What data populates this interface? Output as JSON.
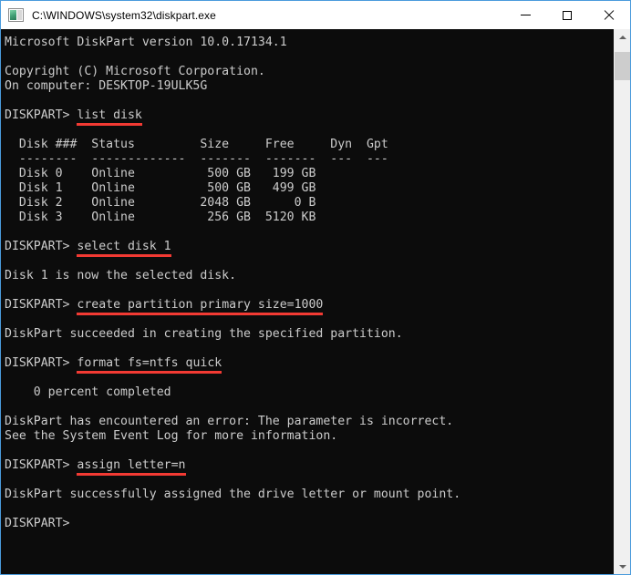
{
  "window": {
    "title": "C:\\WINDOWS\\system32\\diskpart.exe",
    "icon": "console-icon",
    "border_color": "#4a9bdc",
    "controls": {
      "minimize_label": "—",
      "maximize_label": "□",
      "close_label": "✕"
    }
  },
  "terminal": {
    "background": "#0c0c0c",
    "foreground": "#cccccc",
    "highlight_color": "#f23a33",
    "lines": [
      {
        "text": "Microsoft DiskPart version 10.0.17134.1"
      },
      {
        "text": ""
      },
      {
        "text": "Copyright (C) Microsoft Corporation."
      },
      {
        "text": "On computer: DESKTOP-19ULK5G"
      },
      {
        "text": ""
      },
      {
        "prompt": "DISKPART> ",
        "command": "list disk",
        "underline": true
      },
      {
        "text": ""
      },
      {
        "text": "  Disk ###  Status         Size     Free     Dyn  Gpt"
      },
      {
        "text": "  --------  -------------  -------  -------  ---  ---"
      },
      {
        "text": "  Disk 0    Online          500 GB   199 GB"
      },
      {
        "text": "  Disk 1    Online          500 GB   499 GB"
      },
      {
        "text": "  Disk 2    Online         2048 GB      0 B"
      },
      {
        "text": "  Disk 3    Online          256 GB  5120 KB"
      },
      {
        "text": ""
      },
      {
        "prompt": "DISKPART> ",
        "command": "select disk 1",
        "underline": true
      },
      {
        "text": ""
      },
      {
        "text": "Disk 1 is now the selected disk."
      },
      {
        "text": ""
      },
      {
        "prompt": "DISKPART> ",
        "command": "create partition primary size=1000",
        "underline": true
      },
      {
        "text": ""
      },
      {
        "text": "DiskPart succeeded in creating the specified partition."
      },
      {
        "text": ""
      },
      {
        "prompt": "DISKPART> ",
        "command": "format fs=ntfs quick",
        "underline": true
      },
      {
        "text": ""
      },
      {
        "text": "    0 percent completed"
      },
      {
        "text": ""
      },
      {
        "text": "DiskPart has encountered an error: The parameter is incorrect."
      },
      {
        "text": "See the System Event Log for more information."
      },
      {
        "text": ""
      },
      {
        "prompt": "DISKPART> ",
        "command": "assign letter=n",
        "underline": true
      },
      {
        "text": ""
      },
      {
        "text": "DiskPart successfully assigned the drive letter or mount point."
      },
      {
        "text": ""
      },
      {
        "text": "DISKPART>"
      }
    ]
  },
  "disk_table": {
    "headers": [
      "Disk ###",
      "Status",
      "Size",
      "Free",
      "Dyn",
      "Gpt"
    ],
    "rows": [
      [
        "Disk 0",
        "Online",
        "500 GB",
        "199 GB",
        "",
        ""
      ],
      [
        "Disk 1",
        "Online",
        "500 GB",
        "499 GB",
        "",
        ""
      ],
      [
        "Disk 2",
        "Online",
        "2048 GB",
        "0 B",
        "",
        ""
      ],
      [
        "Disk 3",
        "Online",
        "256 GB",
        "5120 KB",
        "",
        ""
      ]
    ]
  },
  "scrollbar": {
    "up_arrow": "chevron-up-icon",
    "down_arrow": "chevron-down-icon",
    "thumb_position_pct": 2,
    "thumb_size_pct": 6
  }
}
